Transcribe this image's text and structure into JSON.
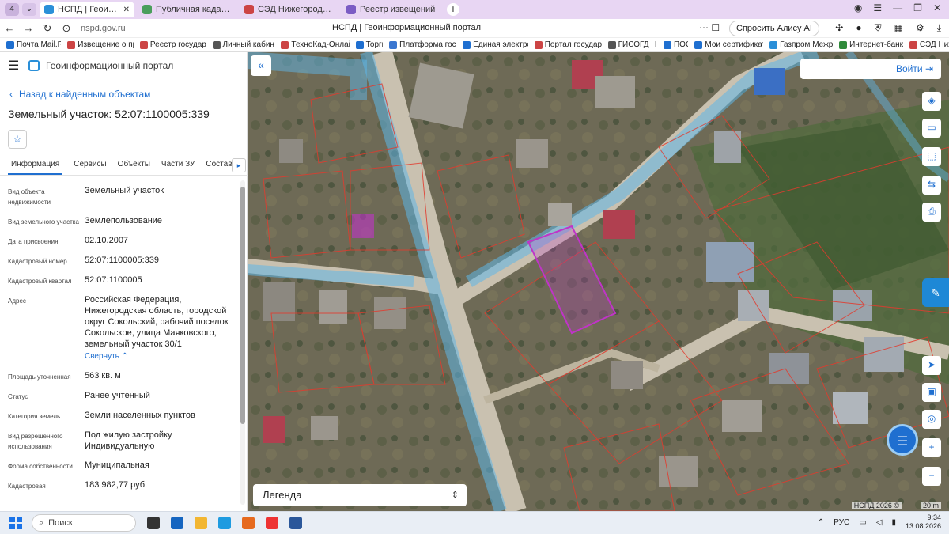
{
  "browser": {
    "tabs": [
      {
        "label": "НСПД | Геоинформацио",
        "active": true,
        "color": "#2a8fd8"
      },
      {
        "label": "Публичная кадастровая",
        "active": false,
        "color": "#4a9e5c"
      },
      {
        "label": "СЭД Нижегородская обл",
        "active": false,
        "color": "#c44"
      },
      {
        "label": "Реестр извещений",
        "active": false,
        "color": "#7b5cc4"
      }
    ],
    "workspace_badge": "4",
    "url": "nspd.gov.ru",
    "page_title": "НСПД | Геоинформационный портал",
    "alice_button": "Спросить Алису AI",
    "bookmarks": [
      {
        "label": "Почта Mail.Ru",
        "color": "#1f6fd0"
      },
      {
        "label": "Извещение о про",
        "color": "#c44"
      },
      {
        "label": "Реестр государст",
        "color": "#c44"
      },
      {
        "label": "Личный кабинет",
        "color": "#555"
      },
      {
        "label": "ТехноКад-Онлайн",
        "color": "#c44"
      },
      {
        "label": "Торги",
        "color": "#1f6fd0"
      },
      {
        "label": "Платформа госуд",
        "color": "#3a76d0"
      },
      {
        "label": "Единая электрон",
        "color": "#1f6fd0"
      },
      {
        "label": "Портал государст",
        "color": "#c44"
      },
      {
        "label": "ГИСОГД НО",
        "color": "#555"
      },
      {
        "label": "ПОС",
        "color": "#1f6fd0"
      },
      {
        "label": "Мои сертификаты",
        "color": "#1f6fd0"
      },
      {
        "label": "Газпром Межрег",
        "color": "#2a8fd8"
      },
      {
        "label": "Интернет-банк Р",
        "color": "#2f8a3a"
      },
      {
        "label": "СЭД Ниж",
        "color": "#c44"
      }
    ]
  },
  "portal": {
    "title": "Геоинформационный портал",
    "back_link": "Назад к найденным объектам",
    "object_title": "Земельный участок: 52:07:1100005:339",
    "tabs": [
      "Информация",
      "Сервисы",
      "Объекты",
      "Части ЗУ",
      "Состав"
    ],
    "properties": [
      {
        "label": "Вид объекта недвижимости",
        "value": "Земельный участок"
      },
      {
        "label": "Вид земельного участка",
        "value": "Землепользование"
      },
      {
        "label": "Дата присвоения",
        "value": "02.10.2007"
      },
      {
        "label": "Кадастровый номер",
        "value": "52:07:1100005:339"
      },
      {
        "label": "Кадастровый квартал",
        "value": "52:07:1100005"
      },
      {
        "label": "Адрес",
        "value": "Российская Федерация, Нижегородская область, городской округ Сокольский, рабочий поселок Сокольское, улица Маяковского, земельный участок 30/1"
      },
      {
        "label": "Площадь уточненная",
        "value": "563 кв. м"
      },
      {
        "label": "Статус",
        "value": "Ранее учтенный"
      },
      {
        "label": "Категория земель",
        "value": "Земли населенных пунктов"
      },
      {
        "label": "Вид разрешенного использования",
        "value": "Под жилую застройку Индивидуальную"
      },
      {
        "label": "Форма собственности",
        "value": "Муниципальная"
      },
      {
        "label": "Кадастровая",
        "value": "183 982,77 руб."
      }
    ],
    "collapse_link": "Свернуть"
  },
  "map": {
    "login_button": "Войти",
    "legend_label": "Легенда",
    "copyright": "НСПД 2026 ©",
    "scale_label": "20 m",
    "colors": {
      "road_highlight": "#5fb6e8",
      "parcel_border": "#e23b2e",
      "selected_parcel": "#c034c8"
    }
  },
  "taskbar": {
    "search_placeholder": "Поиск",
    "language": "РУС",
    "time": "9:34",
    "date": "13.08.2026"
  }
}
